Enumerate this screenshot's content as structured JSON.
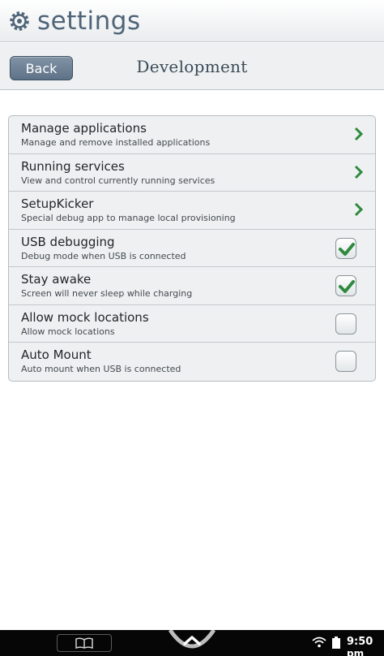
{
  "header": {
    "title": "settings",
    "icon": "gear-icon"
  },
  "subbar": {
    "back_label": "Back",
    "title": "Development"
  },
  "list": {
    "items": [
      {
        "title": "Manage applications",
        "subtitle": "Manage and remove installed applications",
        "control": "chevron"
      },
      {
        "title": "Running services",
        "subtitle": "View and control currently running services",
        "control": "chevron"
      },
      {
        "title": "SetupKicker",
        "subtitle": "Special debug app to manage local provisioning",
        "control": "chevron"
      },
      {
        "title": "USB debugging",
        "subtitle": "Debug mode when USB is connected",
        "control": "checkbox",
        "checked": true
      },
      {
        "title": "Stay awake",
        "subtitle": "Screen will never sleep while charging",
        "control": "checkbox",
        "checked": true
      },
      {
        "title": "Allow mock locations",
        "subtitle": "Allow mock locations",
        "control": "checkbox",
        "checked": false
      },
      {
        "title": "Auto Mount",
        "subtitle": "Auto mount when USB is connected",
        "control": "checkbox",
        "checked": false
      }
    ]
  },
  "status_bar": {
    "time": "9:50",
    "ampm": "pm",
    "icons": [
      "book-icon",
      "home-icon",
      "wifi-icon",
      "battery-icon"
    ]
  },
  "colors": {
    "accent_green": "#2e8a3e",
    "header_text": "#4f6478",
    "back_button": "#6f8296"
  }
}
